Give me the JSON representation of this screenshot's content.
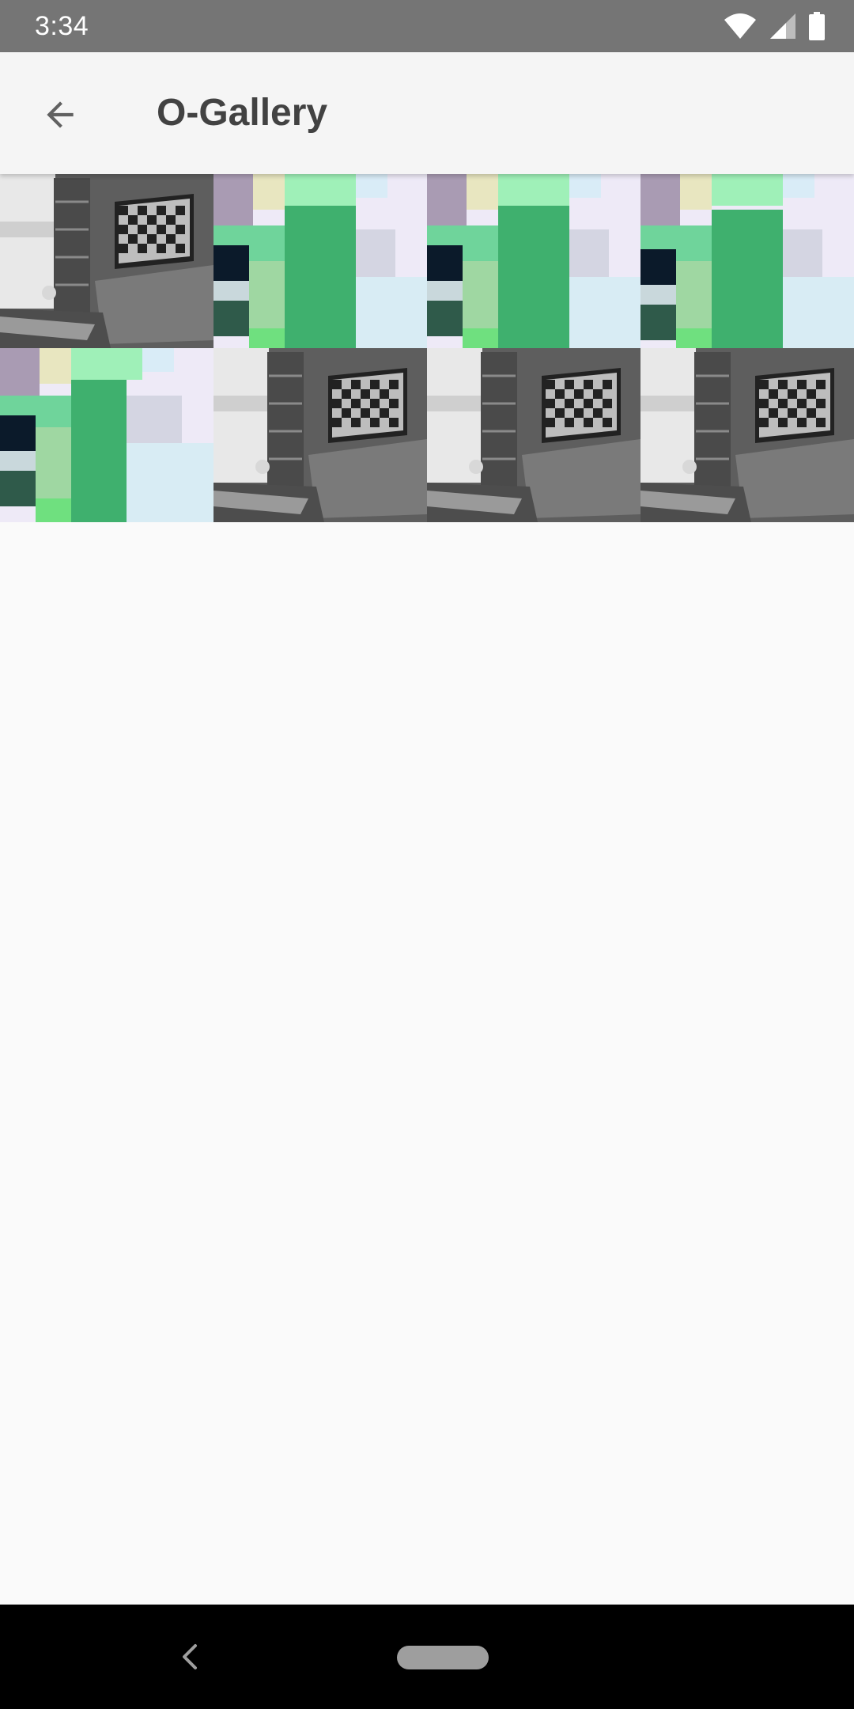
{
  "status_bar": {
    "time": "3:34",
    "icons": [
      "wifi-icon",
      "cell-signal-icon",
      "battery-icon"
    ]
  },
  "app_bar": {
    "title": "O-Gallery",
    "back_icon": "arrow-back-icon"
  },
  "gallery": {
    "items": [
      {
        "kind": "room-photo"
      },
      {
        "kind": "color-blocks"
      },
      {
        "kind": "color-blocks"
      },
      {
        "kind": "color-blocks"
      },
      {
        "kind": "color-blocks"
      },
      {
        "kind": "room-photo"
      },
      {
        "kind": "room-photo"
      },
      {
        "kind": "room-photo"
      }
    ]
  },
  "nav_bar": {
    "back_icon": "nav-back-icon",
    "home_icon": "home-pill-icon"
  },
  "colors": {
    "status_bar": "#757575",
    "app_bar": "#f5f5f5",
    "background": "#fafafa",
    "nav_bar": "#000000"
  }
}
